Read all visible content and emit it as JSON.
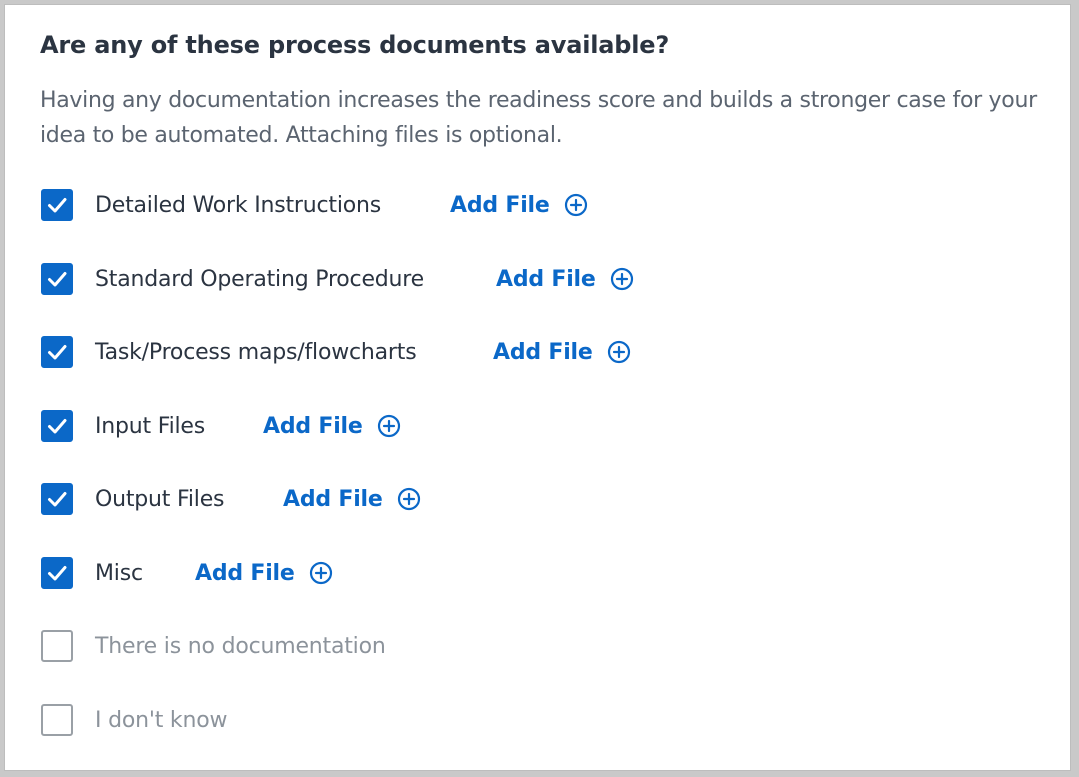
{
  "question": {
    "title": "Are any of these process documents available?",
    "description": "Having any documentation increases the readiness score and builds a stronger case for your idea to be automated. Attaching files is optional."
  },
  "add_file_label": "Add File",
  "icons": {
    "checked": "checkmark-icon",
    "add": "plus-circle-icon"
  },
  "colors": {
    "accent": "#0b68c8",
    "text": "#2b3441",
    "muted": "#8c939b",
    "checkbox_border": "#9aa0a6"
  },
  "documents": [
    {
      "label": "Detailed Work Instructions",
      "checked": true,
      "has_add": true
    },
    {
      "label": "Standard Operating Procedure",
      "checked": true,
      "has_add": true
    },
    {
      "label": "Task/Process maps/flowcharts",
      "checked": true,
      "has_add": true
    },
    {
      "label": "Input Files",
      "checked": true,
      "has_add": true
    },
    {
      "label": "Output Files",
      "checked": true,
      "has_add": true
    },
    {
      "label": "Misc",
      "checked": true,
      "has_add": true
    },
    {
      "label": "There is no documentation",
      "checked": false,
      "has_add": false
    },
    {
      "label": "I don't know",
      "checked": false,
      "has_add": false
    }
  ]
}
